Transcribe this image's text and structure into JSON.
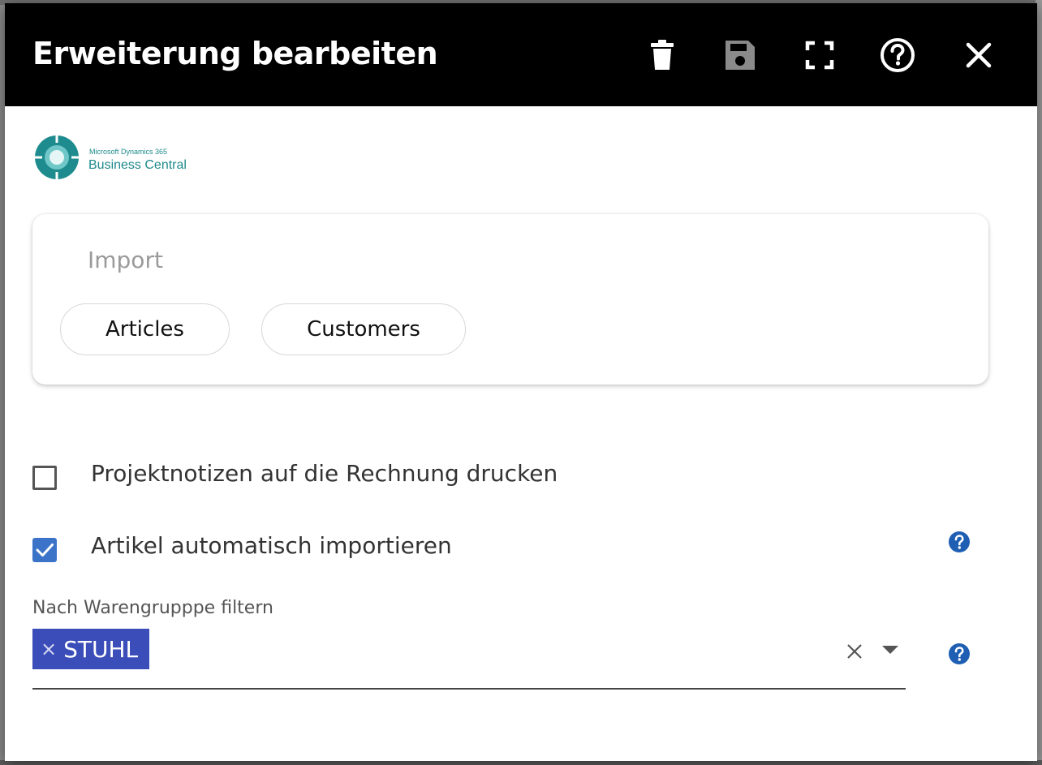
{
  "dialog": {
    "title": "Erweiterung bearbeiten",
    "actions": [
      "delete-icon",
      "save-icon",
      "fullscreen-icon",
      "help-icon",
      "close-icon"
    ]
  },
  "logo": {
    "line_small": "Microsoft Dynamics 365",
    "line_big": "Business Central"
  },
  "import": {
    "label": "Import",
    "buttons": [
      "Articles",
      "Customers"
    ]
  },
  "options": [
    {
      "label": "Projektnotizen auf die Rechnung drucken",
      "checked": false
    },
    {
      "label": "Artikel automatisch importieren",
      "checked": true
    }
  ],
  "filter": {
    "label": "Nach Warengrupppe filtern",
    "selected": [
      "STUHL"
    ],
    "chip_remove": "×"
  },
  "colors": {
    "header_bg": "#000000",
    "checkbox_checked": "#3b73c8",
    "chip_bg": "#3b4db8",
    "help_icon": "#1e5fb3",
    "logo_teal": "#1f8a8c"
  }
}
